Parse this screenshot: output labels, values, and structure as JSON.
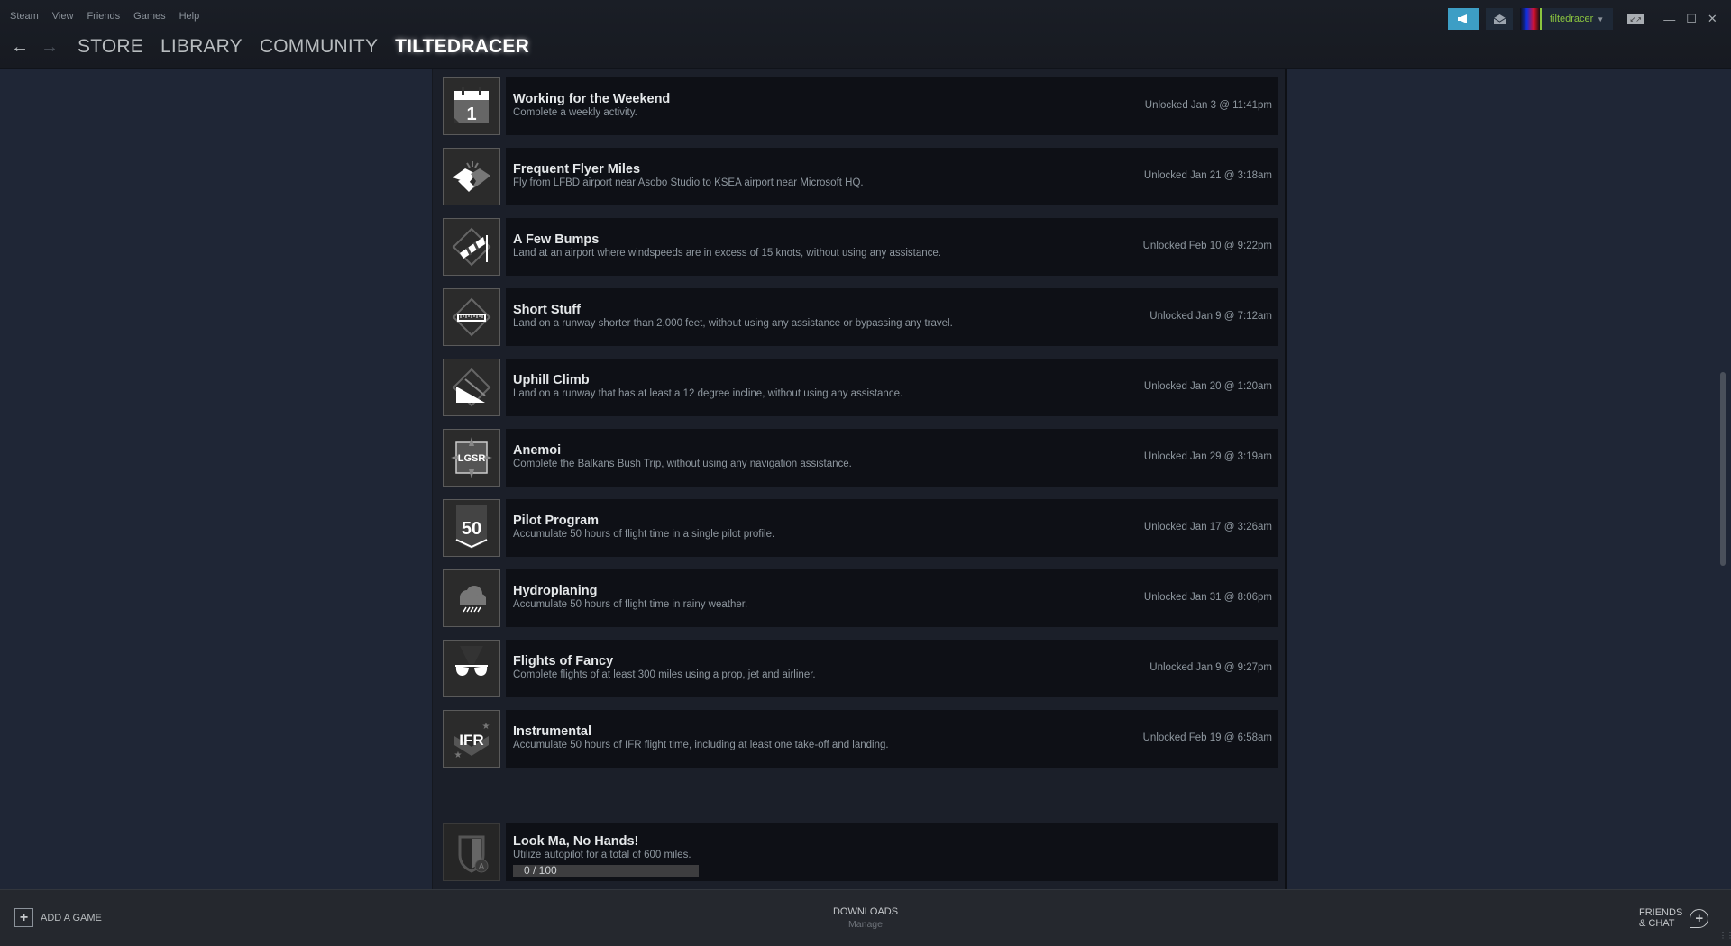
{
  "menu": [
    "Steam",
    "View",
    "Friends",
    "Games",
    "Help"
  ],
  "nav": {
    "back_icon": "arrow-left-icon",
    "forward_icon": "arrow-right-icon",
    "tabs": [
      {
        "label": "STORE",
        "active": false
      },
      {
        "label": "LIBRARY",
        "active": false
      },
      {
        "label": "COMMUNITY",
        "active": false
      },
      {
        "label": "TILTEDRACER",
        "active": true
      }
    ]
  },
  "top_right": {
    "announce_icon": "megaphone-icon",
    "inbox_icon": "envelope-icon",
    "username": "tiltedracer",
    "accent_color": "#3d9ec5",
    "username_color": "#8bc53f"
  },
  "achievements": [
    {
      "name": "Working for the Weekend",
      "desc": "Complete a weekly activity.",
      "unlocked": "Unlocked Jan 3 @ 11:41pm",
      "icon": "calendar-icon"
    },
    {
      "name": "Frequent Flyer Miles",
      "desc": "Fly from LFBD airport near Asobo Studio to KSEA airport near Microsoft HQ.",
      "unlocked": "Unlocked Jan 21 @ 3:18am",
      "icon": "handshake-icon"
    },
    {
      "name": "A Few Bumps",
      "desc": "Land at an airport where windspeeds are in excess of 15 knots, without using any assistance.",
      "unlocked": "Unlocked Feb 10 @ 9:22pm",
      "icon": "windsock-icon"
    },
    {
      "name": "Short Stuff",
      "desc": "Land on a runway shorter than 2,000 feet, without using any assistance or bypassing any travel.",
      "unlocked": "Unlocked Jan 9 @ 7:12am",
      "icon": "ruler-icon"
    },
    {
      "name": "Uphill Climb",
      "desc": "Land on a runway that has at least a 12 degree incline, without using any assistance.",
      "unlocked": "Unlocked Jan 20 @ 1:20am",
      "icon": "incline-icon"
    },
    {
      "name": "Anemoi",
      "desc": "Complete the Balkans Bush Trip, without using any navigation assistance.",
      "unlocked": "Unlocked Jan 29 @ 3:19am",
      "icon": "compass-icon",
      "icon_text": "LGSR"
    },
    {
      "name": "Pilot Program",
      "desc": "Accumulate 50 hours of flight time in a single pilot profile.",
      "unlocked": "Unlocked Jan 17 @ 3:26am",
      "icon": "badge-50-icon",
      "icon_text": "50"
    },
    {
      "name": "Hydroplaning",
      "desc": "Accumulate 50 hours of flight time in rainy weather.",
      "unlocked": "Unlocked Jan 31 @ 8:06pm",
      "icon": "rain-cloud-icon"
    },
    {
      "name": "Flights of Fancy",
      "desc": "Complete flights of at least 300 miles using a prop, jet and airliner.",
      "unlocked": "Unlocked Jan 9 @ 9:27pm",
      "icon": "aviator-sunglasses-icon"
    },
    {
      "name": "Instrumental",
      "desc": "Accumulate 50 hours of IFR flight time, including at least one take-off and landing.",
      "unlocked": "Unlocked Feb 19 @ 6:58am",
      "icon": "ifr-chevron-icon",
      "icon_text": "IFR"
    }
  ],
  "locked_achievement": {
    "name": "Look Ma, No Hands!",
    "desc": "Utilize autopilot for a total of 600 miles.",
    "progress_text": "0 / 100",
    "progress_value": 0,
    "progress_max": 100,
    "icon": "autopilot-shield-icon"
  },
  "bottom": {
    "add_game": "ADD A GAME",
    "downloads": "DOWNLOADS",
    "downloads_sub": "Manage",
    "friends_line1": "FRIENDS",
    "friends_line2": "& CHAT"
  }
}
